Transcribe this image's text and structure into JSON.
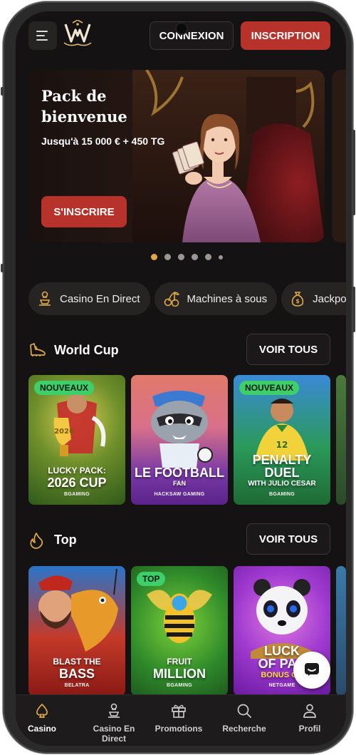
{
  "header": {
    "menu_icon": "hamburger-menu-icon",
    "logo_icon": "w-crown-logo-icon",
    "login_label": "CONNEXION",
    "signup_label": "INSCRIPTION"
  },
  "banner": {
    "title_line1": "Pack de",
    "title_line2": "bienvenue",
    "subtitle": "Jusqu'à 15 000 € + 450 TG",
    "cta_label": "S'INSCRIRE",
    "slide_count": 6,
    "active_slide": 1
  },
  "categories": [
    {
      "label": "Casino En Direct",
      "icon": "dealer-icon"
    },
    {
      "label": "Machines à sous",
      "icon": "cherries-icon"
    },
    {
      "label": "Jackpots",
      "icon": "money-bag-icon"
    }
  ],
  "sections": {
    "world_cup": {
      "title": "World Cup",
      "icon": "football-boot-icon",
      "see_all_label": "VOIR TOUS",
      "games": [
        {
          "badge": "NOUVEAUX",
          "name_line1": "LUCKY PACK:",
          "name_line2": "2026 CUP",
          "provider": "BGAMING"
        },
        {
          "badge": "",
          "name_line1": "LE FOOTBALL",
          "name_line2": "FAN",
          "provider": "HACKSAW GAMING"
        },
        {
          "badge": "NOUVEAUX",
          "name_line1": "PENALTY",
          "name_line2": "DUEL",
          "name_line3": "WITH JULIO CESAR",
          "provider": "BGAMING"
        }
      ]
    },
    "top": {
      "title": "Top",
      "icon": "flame-icon",
      "see_all_label": "VOIR TOUS",
      "games": [
        {
          "badge": "",
          "name_line1": "BLAST THE",
          "name_line2": "BASS",
          "provider": "BELATRA"
        },
        {
          "badge": "TOP",
          "name_line1": "FRUIT",
          "name_line2": "MILLION",
          "provider": "BGAMING"
        },
        {
          "badge": "",
          "name_line1": "LUCK",
          "name_line2": "OF PAN",
          "name_line3": "BONUS CO",
          "provider": "NETGAME"
        }
      ]
    }
  },
  "chat": {
    "icon": "chat-bubble-icon"
  },
  "bottom_nav": [
    {
      "label": "Casino",
      "icon": "spade-icon",
      "active": true
    },
    {
      "label": "Casino En Direct",
      "icon": "dealer-icon",
      "active": false
    },
    {
      "label": "Promotions",
      "icon": "gift-icon",
      "active": false
    },
    {
      "label": "Recherche",
      "icon": "search-icon",
      "active": false
    },
    {
      "label": "Profil",
      "icon": "user-icon",
      "active": false
    }
  ],
  "colors": {
    "background": "#141212",
    "accent_red": "#b8322c",
    "accent_gold": "#e0a94a",
    "badge_green": "#3ecf6a"
  }
}
